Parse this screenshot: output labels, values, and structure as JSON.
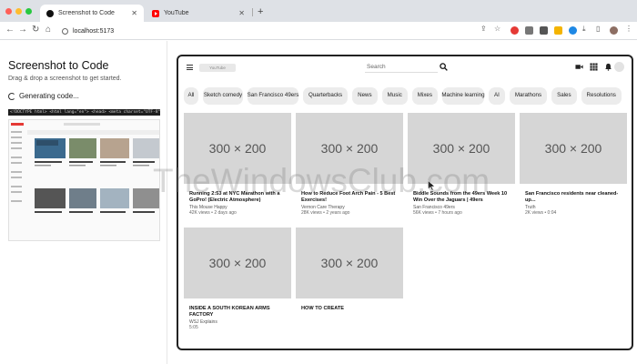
{
  "browser": {
    "tabs": [
      {
        "title": "Screenshot to Code",
        "active": true
      },
      {
        "title": "YouTube",
        "active": false
      }
    ],
    "url": "localhost:5173"
  },
  "app": {
    "title": "Screenshot to Code",
    "subtitle": "Drag & drop a screenshot to get started.",
    "status": "Generating code...",
    "code_preview": "<!DOCTYPE html> <html lang=\"en\"> <head> <meta charset=\"UTF-8\"> <meta name=\"viewport\""
  },
  "youtube": {
    "search_placeholder": "Search",
    "logo_placeholder": "YouTube",
    "chips": [
      "All",
      "Sketch comedy",
      "San Francisco 49ers",
      "Quarterbacks",
      "News",
      "Music",
      "Mixes",
      "Machine learning",
      "AI",
      "Marathons",
      "Sales",
      "Resolutions"
    ],
    "videos": [
      {
        "thumb": "300 × 200",
        "title": "Running 2:53 at NYC Marathon with a GoPro! (Electric Atmosphere)",
        "channel": "This Mouse Happy",
        "meta": "42K views • 2 days ago"
      },
      {
        "thumb": "300 × 200",
        "title": "How to Reduce Foot Arch Pain - 5 Best Exercises!",
        "channel": "Vernon Care Therapy",
        "meta": "28K views • 2 years ago"
      },
      {
        "thumb": "300 × 200",
        "title": "Biddle Sounds from the 49ers Week 10 Win Over the Jaguars | 49ers",
        "channel": "San Francisco 49ers",
        "meta": "56K views • 7 hours ago"
      },
      {
        "thumb": "300 × 200",
        "title": "San Francisco residents near cleaned-up...",
        "channel": "Truth",
        "meta": "2K views • 0:04"
      },
      {
        "thumb": "300 × 200",
        "title": "INSIDE A SOUTH KOREAN ARMS FACTORY",
        "channel": "WSJ Explains",
        "meta": "5:05"
      },
      {
        "thumb": "300 × 200",
        "title": "HOW TO CREATE",
        "channel": "",
        "meta": ""
      }
    ]
  },
  "watermark": "TheWindowsClub.com",
  "colors": {
    "accent_red": "#ff0000",
    "tab_bar": "#dee1e6",
    "thumb_gray": "#d6d6d6",
    "chip_gray": "#ececec"
  }
}
